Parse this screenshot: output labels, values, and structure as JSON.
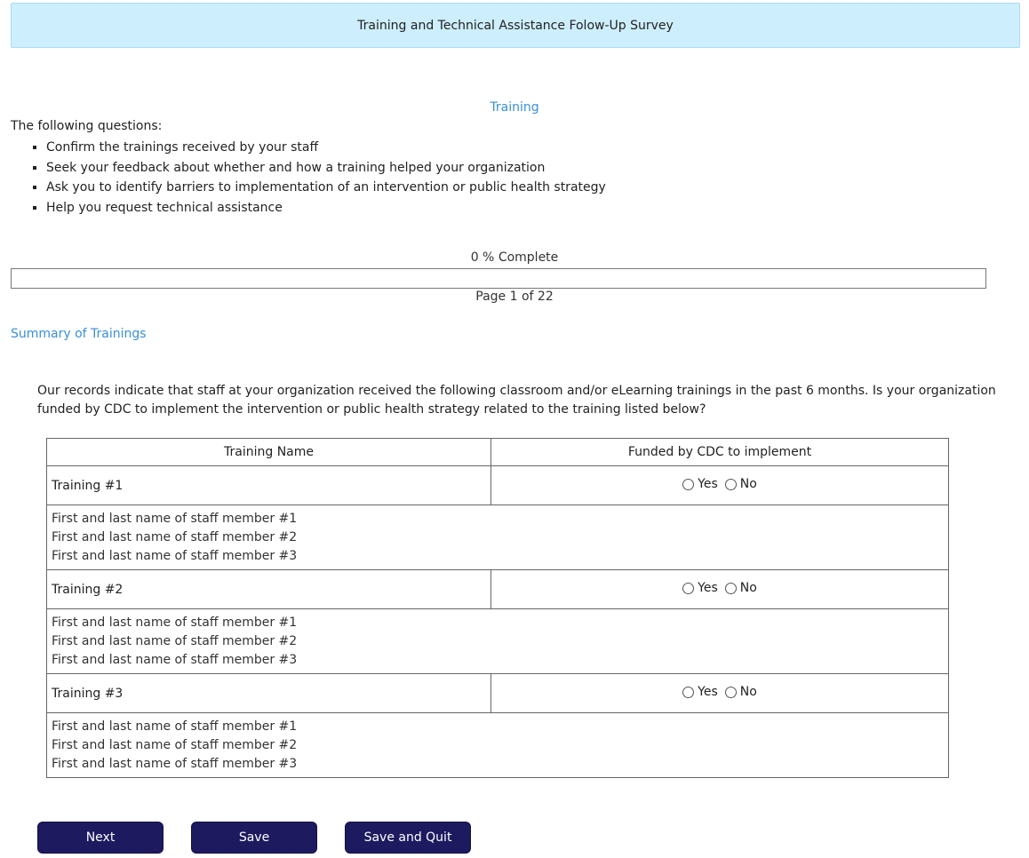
{
  "header": {
    "title": "Training and Technical Assistance Folow-Up Survey"
  },
  "section": {
    "title": "Training"
  },
  "intro": {
    "lead": "The following questions:",
    "items": [
      "Confirm the trainings received by your staff",
      "Seek your feedback about whether and how a training helped your organization",
      "Ask you to identify barriers to implementation of an intervention or public health strategy",
      "Help you request technical assistance"
    ]
  },
  "progress": {
    "label": "0 % Complete",
    "percent": 0,
    "page": "Page 1 of 22"
  },
  "summary": {
    "link": "Summary of Trainings"
  },
  "question": {
    "text": "Our records indicate that staff at your organization received the following classroom and/or eLearning trainings in the past 6 months. Is your organization funded by CDC to implement the intervention or public health strategy related to the training listed below?"
  },
  "table": {
    "headers": [
      "Training Name",
      "Funded by CDC to implement"
    ],
    "yes_label": "Yes",
    "no_label": "No",
    "rows": [
      {
        "name": "Training #1",
        "staff": [
          "First and last name of staff member #1",
          "First and last name of staff member #2",
          "First and last name of staff member #3"
        ]
      },
      {
        "name": "Training #2",
        "staff": [
          "First and last name of staff member #1",
          "First and last name of staff member #2",
          "First and last name of staff member #3"
        ]
      },
      {
        "name": "Training #3",
        "staff": [
          "First and last name of staff member #1",
          "First and last name of staff member #2",
          "First and last name of staff member #3"
        ]
      }
    ]
  },
  "buttons": {
    "next": "Next",
    "save": "Save",
    "save_quit": "Save and Quit"
  },
  "colors": {
    "header_bg": "#cdeefc",
    "accent_link": "#3a8fd8",
    "button_bg": "#1e1a5f"
  }
}
